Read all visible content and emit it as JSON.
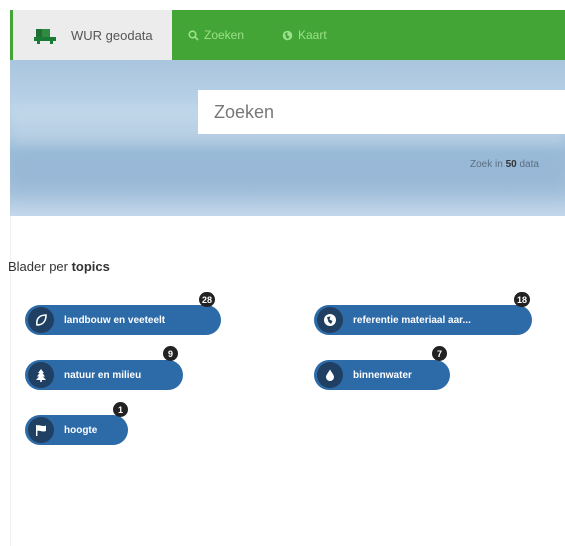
{
  "navbar": {
    "brand": "WUR geodata",
    "items": [
      {
        "label": "Zoeken",
        "icon": "search-icon"
      },
      {
        "label": "Kaart",
        "icon": "globe-icon"
      }
    ],
    "colors": {
      "bar": "#43a536",
      "brand_bg": "#ececec",
      "item_text": "#9be08a"
    }
  },
  "hero": {
    "search_placeholder": "Zoeken",
    "hint_prefix": "Zoek in ",
    "hint_count": "50",
    "hint_suffix": " data"
  },
  "topics": {
    "title_prefix": "Blader per ",
    "title_bold": "topics",
    "pill_color": "#2c6aa8",
    "items": [
      {
        "label": "landbouw en veeteelt",
        "count": "28",
        "icon": "leaf-icon"
      },
      {
        "label": "referentie materiaal aar...",
        "count": "18",
        "icon": "globe-icon"
      },
      {
        "label": "natuur en milieu",
        "count": "9",
        "icon": "tree-icon"
      },
      {
        "label": "binnenwater",
        "count": "7",
        "icon": "water-drop-icon"
      },
      {
        "label": "hoogte",
        "count": "1",
        "icon": "flag-icon"
      }
    ]
  }
}
